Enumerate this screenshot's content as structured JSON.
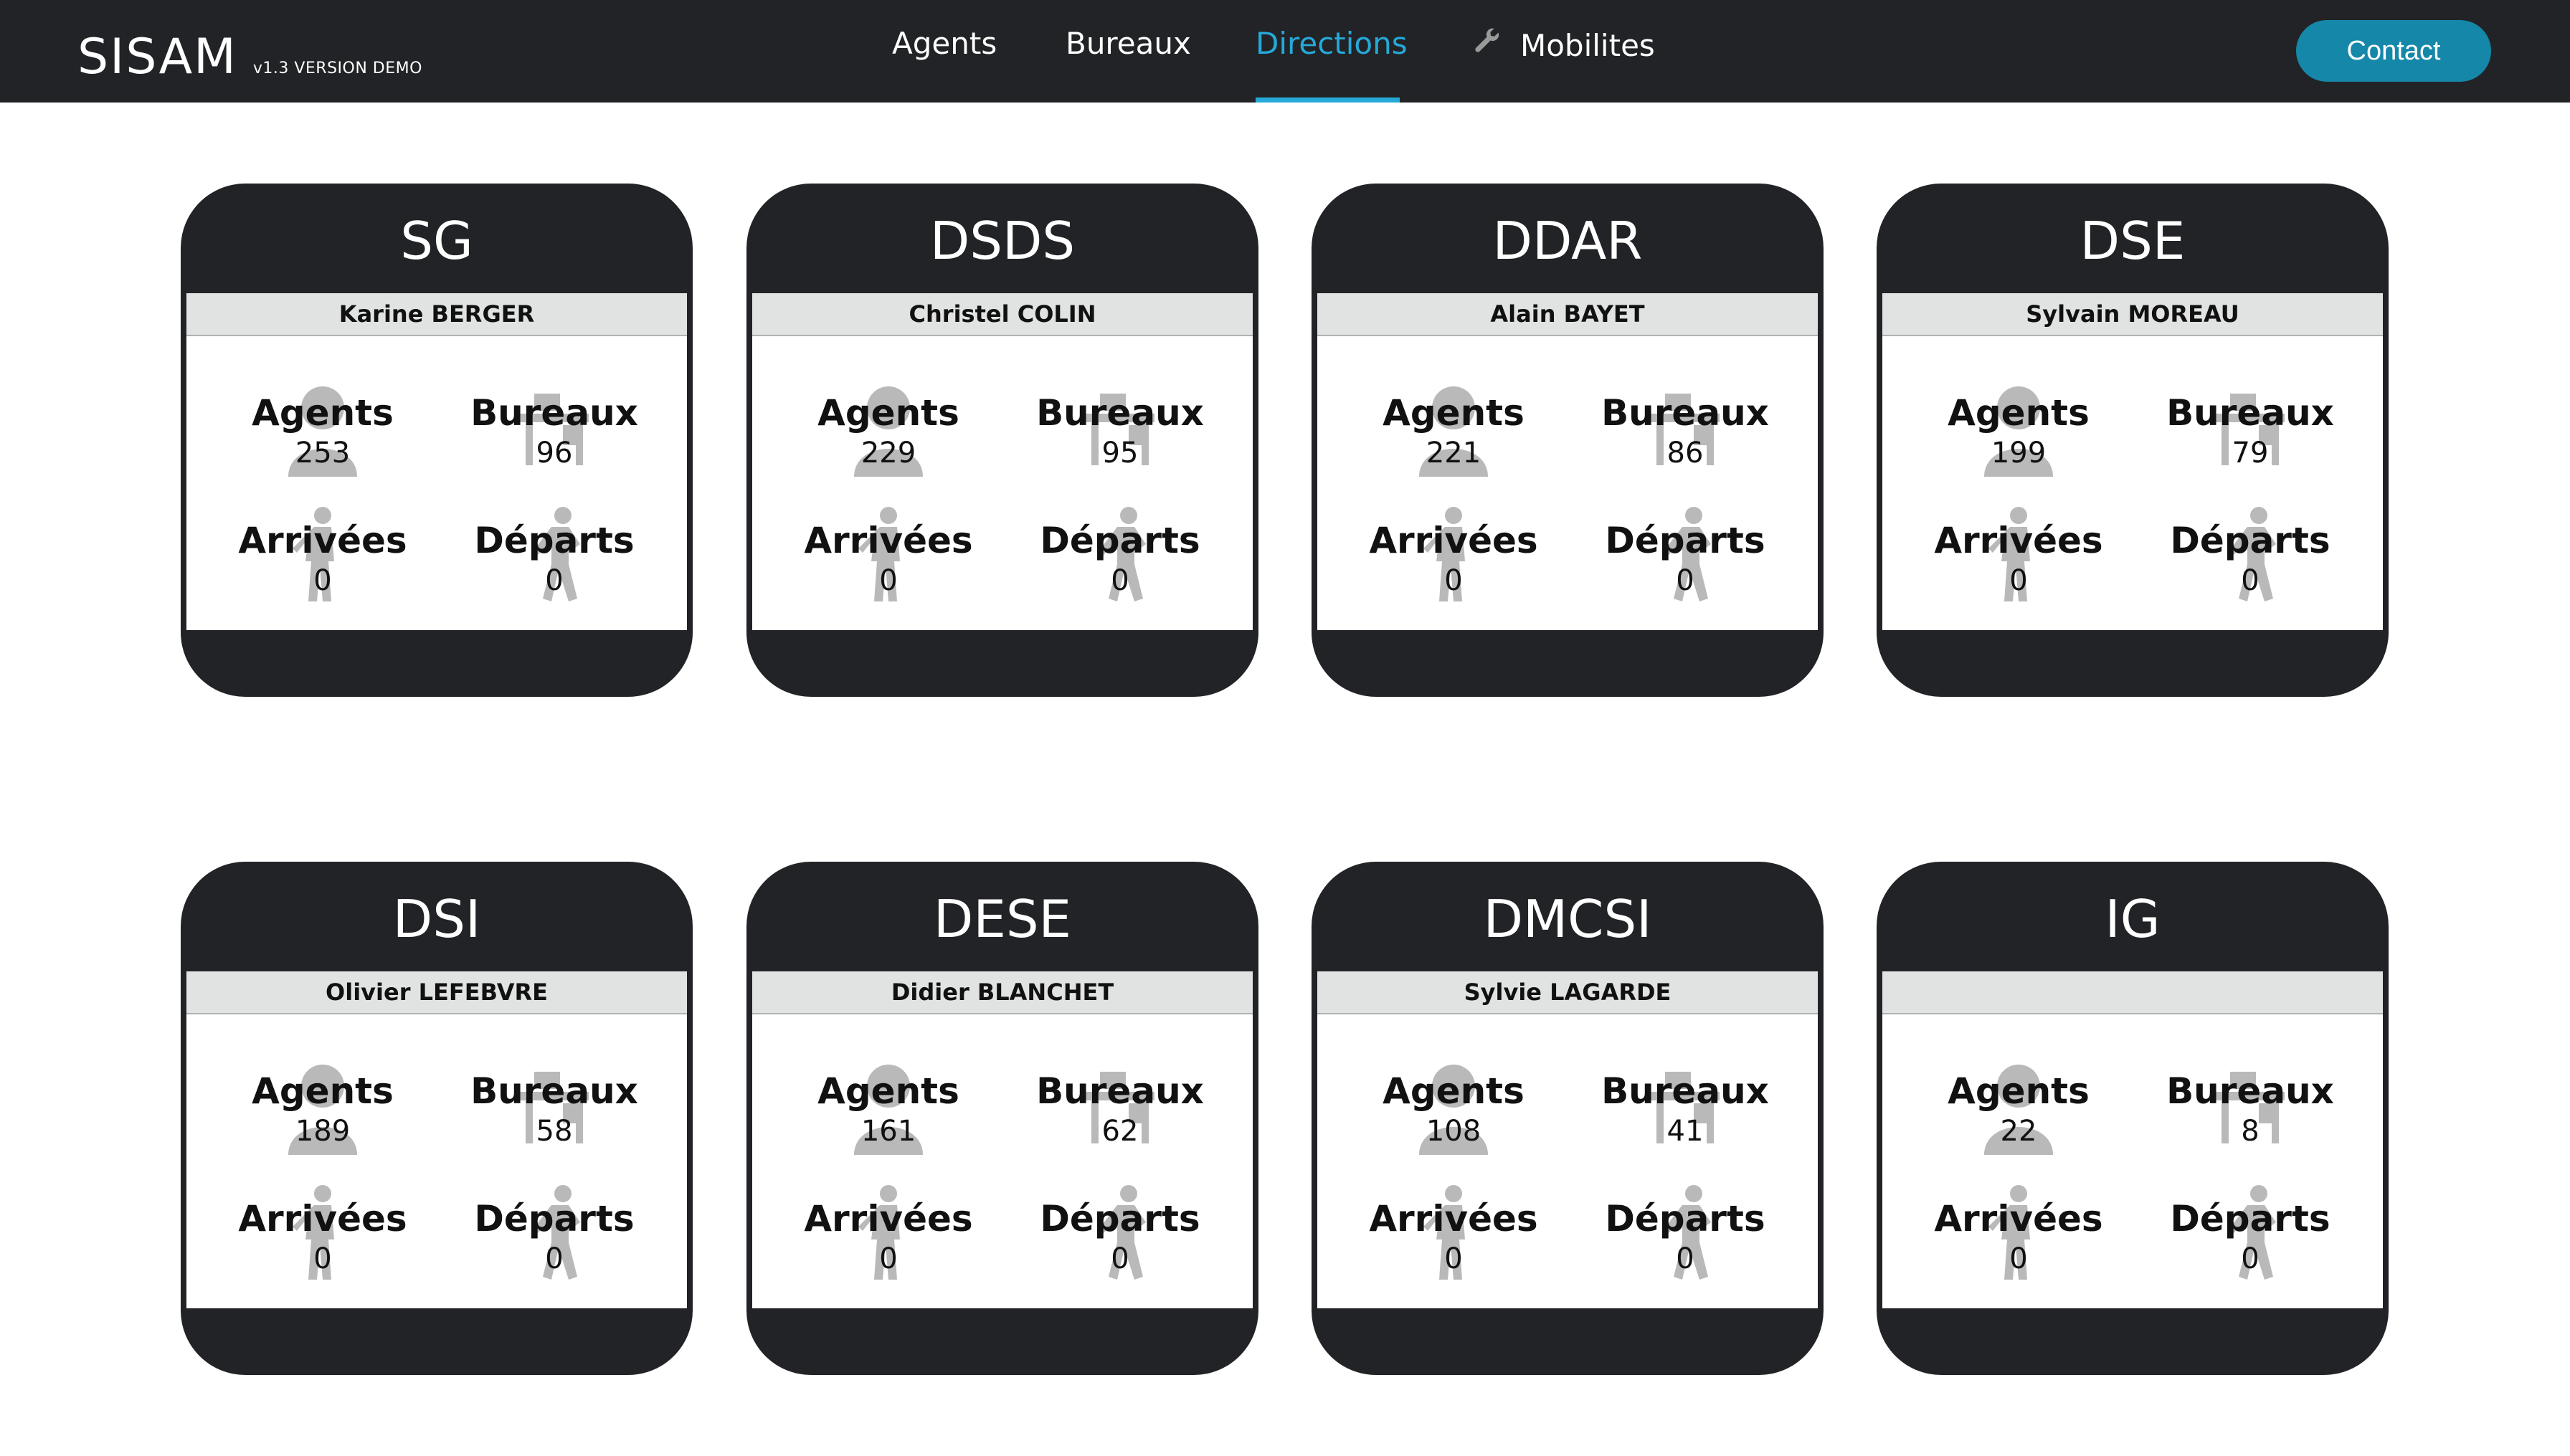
{
  "header": {
    "brand": "SISAM",
    "version": "v1.3 VERSION DEMO",
    "nav": [
      {
        "label": "Agents"
      },
      {
        "label": "Bureaux"
      },
      {
        "label": "Directions"
      },
      {
        "label": "Mobilites"
      }
    ],
    "active_nav": "Directions",
    "contact_label": "Contact",
    "colors": {
      "bar": "#222326",
      "accent": "#25a9d9",
      "button": "#1587a9"
    }
  },
  "stat_labels": {
    "agents": "Agents",
    "bureaux": "Bureaux",
    "arrivees": "Arrivées",
    "departs": "Départs"
  },
  "cards": [
    {
      "code": "SG",
      "chief": "Karine BERGER",
      "agents": "253",
      "bureaux": "96",
      "arrivees": "0",
      "departs": "0"
    },
    {
      "code": "DSDS",
      "chief": "Christel COLIN",
      "agents": "229",
      "bureaux": "95",
      "arrivees": "0",
      "departs": "0"
    },
    {
      "code": "DDAR",
      "chief": "Alain BAYET",
      "agents": "221",
      "bureaux": "86",
      "arrivees": "0",
      "departs": "0"
    },
    {
      "code": "DSE",
      "chief": "Sylvain MOREAU",
      "agents": "199",
      "bureaux": "79",
      "arrivees": "0",
      "departs": "0"
    },
    {
      "code": "DSI",
      "chief": "Olivier LEFEBVRE",
      "agents": "189",
      "bureaux": "58",
      "arrivees": "0",
      "departs": "0"
    },
    {
      "code": "DESE",
      "chief": "Didier BLANCHET",
      "agents": "161",
      "bureaux": "62",
      "arrivees": "0",
      "departs": "0"
    },
    {
      "code": "DMCSI",
      "chief": "Sylvie LAGARDE",
      "agents": "108",
      "bureaux": "41",
      "arrivees": "0",
      "departs": "0"
    },
    {
      "code": "IG",
      "chief": "",
      "agents": "22",
      "bureaux": "8",
      "arrivees": "0",
      "departs": "0"
    }
  ]
}
